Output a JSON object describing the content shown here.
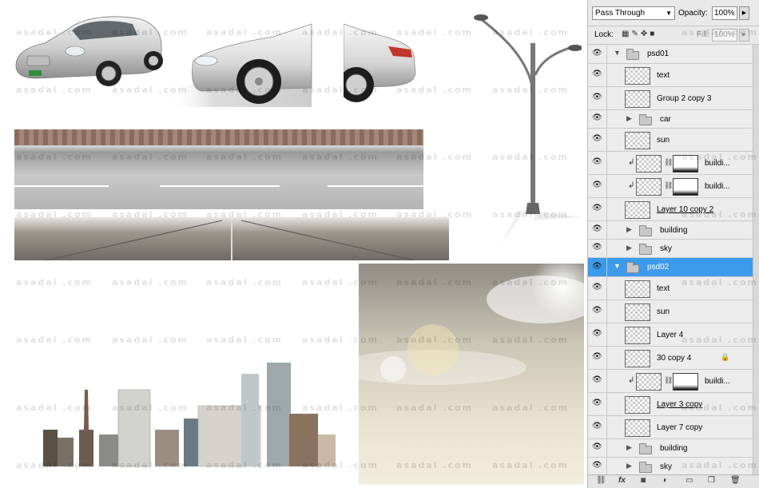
{
  "watermark": "asadal .com",
  "panel": {
    "blend_mode": "Pass Through",
    "opacity_label": "Opacity:",
    "opacity_value": "100%",
    "lock_label": "Lock:",
    "fill_label": "Fill:",
    "fill_value": "100%",
    "layers": [
      {
        "name": "psd01",
        "kind": "group",
        "expanded": true,
        "indent": 0
      },
      {
        "name": "text",
        "kind": "layer",
        "indent": 1
      },
      {
        "name": "Group 2 copy 3",
        "kind": "layer",
        "indent": 1
      },
      {
        "name": "car",
        "kind": "group",
        "expanded": false,
        "indent": 1
      },
      {
        "name": "sun",
        "kind": "layer",
        "indent": 1
      },
      {
        "name": "buildi...",
        "kind": "masked",
        "indent": 1
      },
      {
        "name": "buildi...",
        "kind": "masked",
        "indent": 1
      },
      {
        "name": "Layer 10 copy 2",
        "kind": "layer",
        "indent": 1,
        "underline": true
      },
      {
        "name": "building",
        "kind": "group",
        "expanded": false,
        "indent": 1
      },
      {
        "name": "sky",
        "kind": "group",
        "expanded": false,
        "indent": 1
      },
      {
        "name": "psd02",
        "kind": "group",
        "expanded": true,
        "indent": 0,
        "selected": true
      },
      {
        "name": "text",
        "kind": "layer",
        "indent": 1
      },
      {
        "name": "sun",
        "kind": "layer",
        "indent": 1
      },
      {
        "name": "Layer 4",
        "kind": "layer",
        "indent": 1
      },
      {
        "name": "30 copy 4",
        "kind": "layer",
        "indent": 1,
        "locked": true
      },
      {
        "name": "buildi...",
        "kind": "masked",
        "indent": 1
      },
      {
        "name": "Layer 3 copy",
        "kind": "layer",
        "indent": 1,
        "underline": true
      },
      {
        "name": "Layer 7 copy",
        "kind": "layer",
        "indent": 1
      },
      {
        "name": "building",
        "kind": "group",
        "expanded": false,
        "indent": 1
      },
      {
        "name": "sky",
        "kind": "group",
        "expanded": false,
        "indent": 1
      }
    ],
    "bottom_icons": [
      "link-icon",
      "fx-icon",
      "mask-icon",
      "adjustment-icon",
      "new-group-icon",
      "new-layer-icon",
      "trash-icon"
    ]
  },
  "colors": {
    "selection": "#3d9bec",
    "panel_bg": "#e9e9e9"
  }
}
